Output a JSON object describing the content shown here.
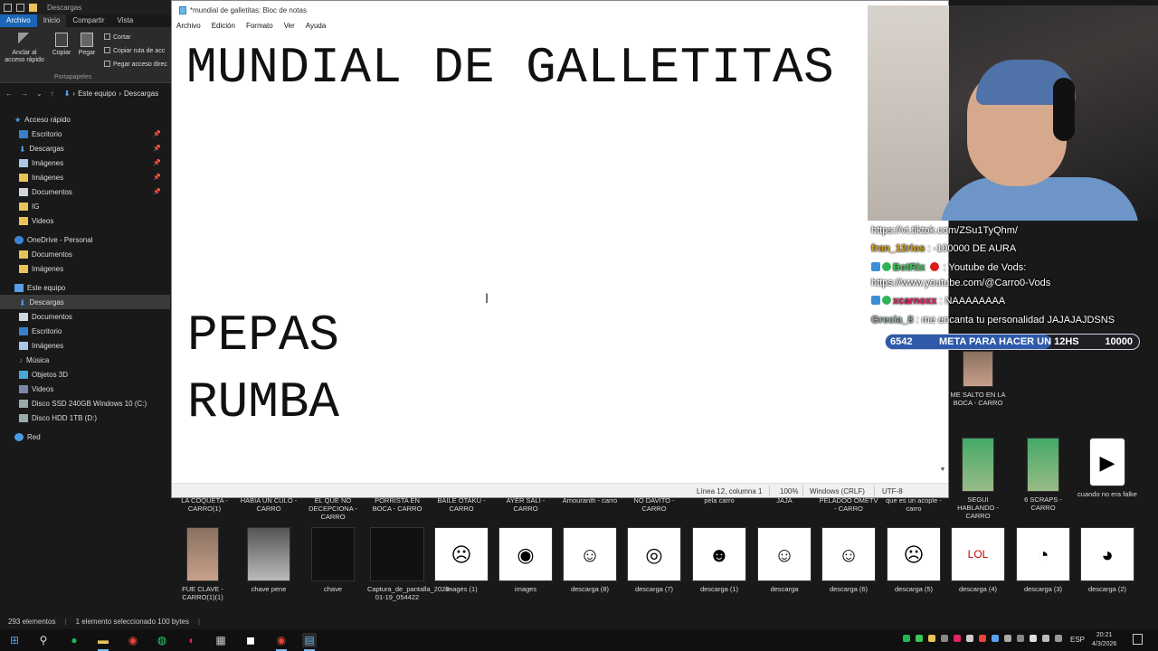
{
  "explorer": {
    "title": "Descargas",
    "tabs": [
      "Archivo",
      "Inicio",
      "Compartir",
      "Vista"
    ],
    "ribbon": {
      "pin": "Anclar al acceso rápido",
      "copy": "Copiar",
      "paste": "Pegar",
      "cut": "Cortar",
      "copy_path": "Copiar ruta de acc",
      "paste_shortcut": "Pegar acceso direc",
      "group": "Portapapeles"
    },
    "address": {
      "root": "Este equipo",
      "folder": "Descargas"
    },
    "nav": {
      "quick_access": "Acceso rápido",
      "quick_items": [
        "Escritorio",
        "Descargas",
        "Imágenes",
        "Imágenes",
        "Documentos",
        "IG",
        "Videos"
      ],
      "onedrive": "OneDrive - Personal",
      "onedrive_items": [
        "Documentos",
        "Imágenes"
      ],
      "this_pc": "Este equipo",
      "pc_items": [
        "Descargas",
        "Documentos",
        "Escritorio",
        "Imágenes",
        "Música",
        "Objetos 3D",
        "Videos",
        "Disco SSD 240GB Windows 10 (C:)",
        "Disco HDD 1TB (D:)"
      ],
      "network": "Red"
    },
    "files_row_top": [
      "LA COQUETA - CARRO(1)",
      "HABIA UN CULO - CARRO",
      "EL QUE NO DECEPCIONA - CARRO",
      "PORRISTA EN BOCA - CARRO",
      "BAILE OTAKU - CARRO",
      "AYER SALI - CARRO",
      "Amouranth - carro",
      "NO DAVITO - CARRO",
      "pela carro",
      "JAJA",
      "PELADOO OMETV - CARRO",
      "que es un acople - carro"
    ],
    "files_right": [
      "ME SALTO EN LA BOCA - CARRO",
      "SEGUI HABLANDO - CARRO",
      "6 SCRAPS - CARRO",
      "cuando no era falke"
    ],
    "files_bottom": [
      "FUE CLAVE - CARRO(1)(1)",
      "chave pene",
      "chave",
      "Captura_de_pantalla_2026-01-19_054422",
      "images (1)",
      "images",
      "descarga (8)",
      "descarga (7)",
      "descarga (1)",
      "descarga",
      "descarga (6)",
      "descarga (5)",
      "descarga (4)",
      "descarga (3)",
      "descarga (2)"
    ],
    "status": {
      "count": "293 elementos",
      "selected": "1 elemento seleccionado  100 bytes"
    }
  },
  "notepad": {
    "title": "*mundial de galletitas: Bloc de notas",
    "menu": [
      "Archivo",
      "Edición",
      "Formato",
      "Ver",
      "Ayuda"
    ],
    "lines": [
      "MUNDIAL DE GALLETITAS",
      "PEPAS",
      "RUMBA"
    ],
    "status": {
      "position": "Línea 12, columna 1",
      "zoom": "100%",
      "eol": "Windows (CRLF)",
      "encoding": "UTF-8"
    }
  },
  "chat": [
    {
      "user": "",
      "text": "https://vt.tiktok.com/ZSu1TyQhm/"
    },
    {
      "user": "fran_12rios",
      "text": " : -100000 DE AURA"
    },
    {
      "user": "BotRix",
      "text": " : Youtube de Vods:"
    },
    {
      "user": "",
      "text": "https://www.youtube.com/@Carro0-Vods"
    },
    {
      "user": "xcarnoxx",
      "text": " : NAAAAAAAA"
    },
    {
      "user": "Grecia_8",
      "text": " : me encanta tu personalidad JAJAJAJDSNS"
    }
  ],
  "goal": {
    "current": "6542",
    "label": "META PARA HACER UN 12HS",
    "target": "10000",
    "progress": 0.6542
  },
  "taskbar": {
    "lang": "ESP",
    "time": "20:21",
    "date": "4/3/2026"
  },
  "colors": {
    "accent": "#1a66b8",
    "goal_fill": "#2e5aa9"
  }
}
